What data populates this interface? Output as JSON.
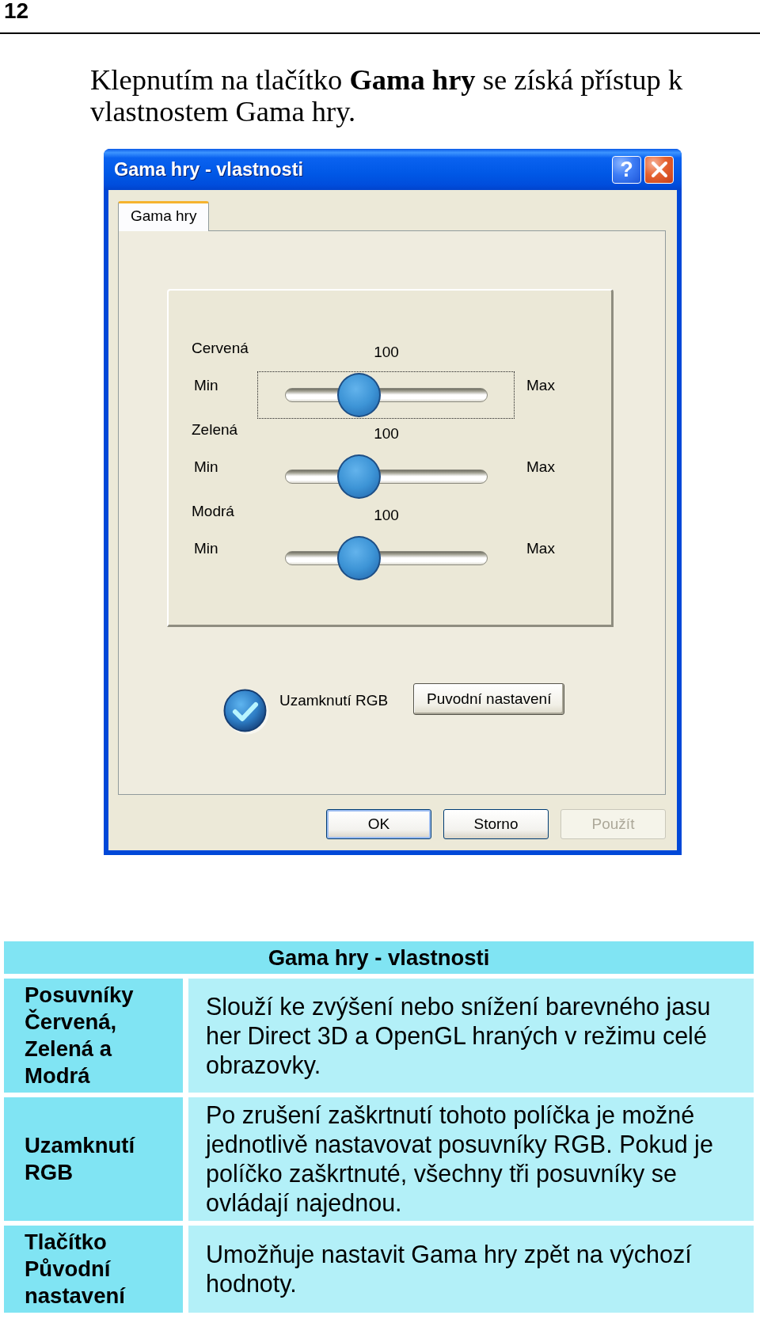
{
  "page_number": "12",
  "intro": "Klepnutím na tlačítko **Gama hry** se získá přístup k vlastnostem Gama hry.",
  "dialog": {
    "title": "Gama hry - vlastnosti",
    "help_button": "?",
    "tabs": [
      {
        "label": "Gama hry",
        "selected": true
      }
    ],
    "sliders": [
      {
        "label": "Cervená",
        "value": "100",
        "min_label": "Min",
        "max_label": "Max",
        "level": 0.33,
        "focused": true
      },
      {
        "label": "Zelená",
        "value": "100",
        "min_label": "Min",
        "max_label": "Max",
        "level": 0.33,
        "focused": false
      },
      {
        "label": "Modrá",
        "value": "100",
        "min_label": "Min",
        "max_label": "Max",
        "level": 0.33,
        "focused": false
      }
    ],
    "lock_rgb": {
      "label": "Uzamknutí RGB",
      "checked": true
    },
    "reset_button": "Puvodní nastavení",
    "buttons": [
      {
        "label": "OK",
        "default": true,
        "disabled": false
      },
      {
        "label": "Storno",
        "default": false,
        "disabled": false
      },
      {
        "label": "Použít",
        "default": false,
        "disabled": true
      }
    ]
  },
  "table": {
    "title": "Gama hry - vlastnosti",
    "rows": [
      {
        "term": "Posuvníky Červená, Zelená a Modrá",
        "description": "Slouží ke zvýšení nebo snížení barevného jasu her Direct 3D a OpenGL hraných v režimu celé obrazovky."
      },
      {
        "term": "Uzamknutí RGB",
        "description": "Po zrušení zaškrtnutí tohoto políčka je možné jednotlivě nastavovat posuvníky RGB. Pokud je políčko zaškrtnuté, všechny tři posuvníky se ovládají najednou."
      },
      {
        "term": "Tlačítko Původní nastavení",
        "description": "Umožňuje nastavit Gama hry zpět na výchozí hodnoty."
      }
    ]
  }
}
